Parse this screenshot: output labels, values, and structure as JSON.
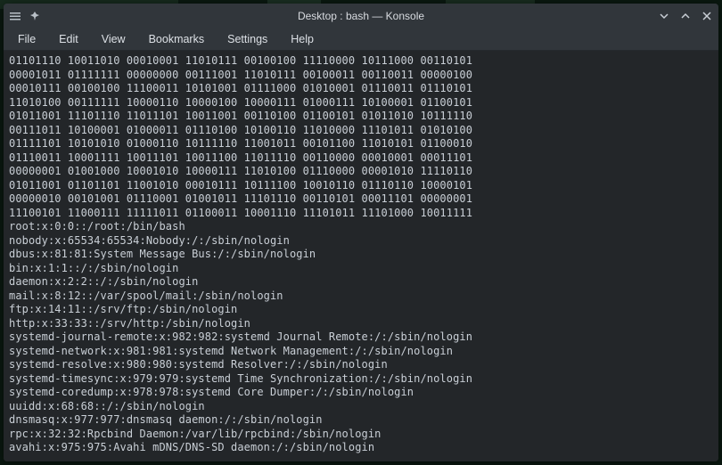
{
  "window": {
    "title": "Desktop : bash — Konsole"
  },
  "menu": {
    "items": [
      "File",
      "Edit",
      "View",
      "Bookmarks",
      "Settings",
      "Help"
    ]
  },
  "icons": {
    "app": "app-icon",
    "pin": "pin-icon",
    "minimize": "minimize-icon",
    "maximize": "maximize-icon",
    "close": "close-icon"
  },
  "terminal": {
    "lines": [
      "01101110 10011010 00010001 11010111 00100100 11110000 10111000 00110101",
      "00001011 01111111 00000000 00111001 11010111 00100011 00110011 00000100",
      "00010111 00100100 11100011 10101001 01111000 01010001 01110011 01110101",
      "11010100 00111111 10000110 10000100 10000111 01000111 10100001 01100101",
      "01011001 11101110 11011101 10011001 00110100 01100101 01011010 10111110",
      "00111011 10100001 01000011 01110100 10100110 11010000 11101011 01010100",
      "01111101 10101010 01000110 10111110 11001011 00101100 11010101 01100010",
      "01110011 10001111 10011101 10011100 11011110 00110000 00010001 00011101",
      "00000001 01001000 10001010 10000111 11010100 01110000 00001010 11110110",
      "01011001 01101101 11001010 00010111 10111100 10010110 01110110 10000101",
      "00000010 00101001 01110001 01001011 11101110 00110101 00011101 00000001",
      "11100101 11000111 11111011 01100011 10001110 11101011 11101000 10011111",
      "root:x:0:0::/root:/bin/bash",
      "nobody:x:65534:65534:Nobody:/:/sbin/nologin",
      "dbus:x:81:81:System Message Bus:/:/sbin/nologin",
      "bin:x:1:1::/:/sbin/nologin",
      "daemon:x:2:2::/:/sbin/nologin",
      "mail:x:8:12::/var/spool/mail:/sbin/nologin",
      "ftp:x:14:11::/srv/ftp:/sbin/nologin",
      "http:x:33:33::/srv/http:/sbin/nologin",
      "systemd-journal-remote:x:982:982:systemd Journal Remote:/:/sbin/nologin",
      "systemd-network:x:981:981:systemd Network Management:/:/sbin/nologin",
      "systemd-resolve:x:980:980:systemd Resolver:/:/sbin/nologin",
      "systemd-timesync:x:979:979:systemd Time Synchronization:/:/sbin/nologin",
      "systemd-coredump:x:978:978:systemd Core Dumper:/:/sbin/nologin",
      "uuidd:x:68:68::/:/sbin/nologin",
      "dnsmasq:x:977:977:dnsmasq daemon:/:/sbin/nologin",
      "rpc:x:32:32:Rpcbind Daemon:/var/lib/rpcbind:/sbin/nologin",
      "avahi:x:975:975:Avahi mDNS/DNS-SD daemon:/:/sbin/nologin"
    ]
  }
}
